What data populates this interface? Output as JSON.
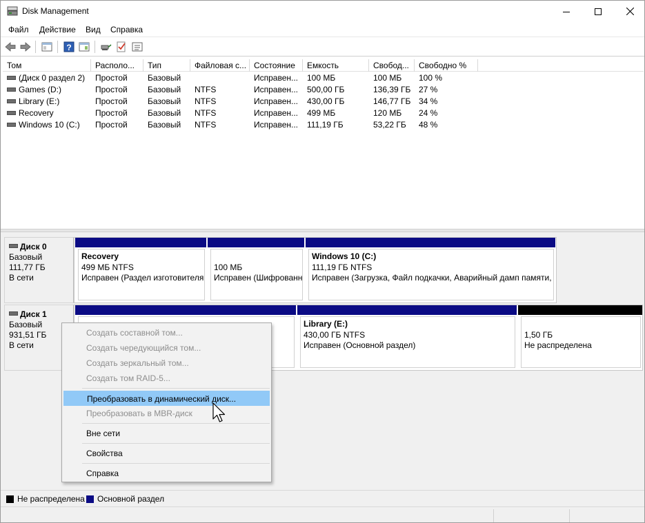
{
  "window": {
    "title": "Disk Management"
  },
  "menu": [
    "Файл",
    "Действие",
    "Вид",
    "Справка"
  ],
  "table": {
    "columns": [
      "Том",
      "Располо...",
      "Тип",
      "Файловая с...",
      "Состояние",
      "Емкость",
      "Свобод...",
      "Свободно %"
    ],
    "rows": [
      [
        "(Диск 0 раздел 2)",
        "Простой",
        "Базовый",
        "",
        "Исправен...",
        "100 МБ",
        "100 МБ",
        "100 %"
      ],
      [
        "Games (D:)",
        "Простой",
        "Базовый",
        "NTFS",
        "Исправен...",
        "500,00 ГБ",
        "136,39 ГБ",
        "27 %"
      ],
      [
        "Library (E:)",
        "Простой",
        "Базовый",
        "NTFS",
        "Исправен...",
        "430,00 ГБ",
        "146,77 ГБ",
        "34 %"
      ],
      [
        "Recovery",
        "Простой",
        "Базовый",
        "NTFS",
        "Исправен...",
        "499 МБ",
        "120 МБ",
        "24 %"
      ],
      [
        "Windows 10 (C:)",
        "Простой",
        "Базовый",
        "NTFS",
        "Исправен...",
        "111,19 ГБ",
        "53,22 ГБ",
        "48 %"
      ]
    ]
  },
  "disk0": {
    "name": "Диск 0",
    "type": "Базовый",
    "size": "111,77 ГБ",
    "status": "В сети",
    "partitions": [
      {
        "title": "Recovery",
        "size": "499 МБ NTFS",
        "status": "Исправен (Раздел изготовителя"
      },
      {
        "title": "",
        "size": "100 МБ",
        "status": "Исправен (Шифрованн"
      },
      {
        "title": "Windows 10  (C:)",
        "size": "111,19 ГБ NTFS",
        "status": "Исправен (Загрузка, Файл подкачки, Аварийный дамп памяти,"
      }
    ]
  },
  "disk1": {
    "name": "Диск 1",
    "type": "Базовый",
    "size": "931,51 ГБ",
    "status": "В сети",
    "partitions": [
      {
        "title": "Library  (E:)",
        "size": "430,00 ГБ NTFS",
        "status": "Исправен (Основной раздел)"
      },
      {
        "title": "",
        "size": "1,50 ГБ",
        "status": "Не распределена"
      }
    ]
  },
  "context_menu": {
    "items": [
      {
        "label": "Создать составной том...",
        "disabled": true
      },
      {
        "label": "Создать чередующийся том...",
        "disabled": true
      },
      {
        "label": "Создать зеркальный том...",
        "disabled": true
      },
      {
        "label": "Создать том RAID-5...",
        "disabled": true
      },
      {
        "label": "Преобразовать в динамический диск...",
        "disabled": false,
        "highlighted": true
      },
      {
        "label": "Преобразовать в MBR-диск",
        "disabled": true
      },
      {
        "label": "Вне сети",
        "disabled": false
      },
      {
        "label": "Свойства",
        "disabled": false
      },
      {
        "label": "Справка",
        "disabled": false
      }
    ]
  },
  "legend": [
    {
      "label": "Не распределена",
      "color": "#000000"
    },
    {
      "label": "Основной раздел",
      "color": "#0b0b84"
    }
  ],
  "icons": [
    "disk-management-icon",
    "back-arrow-icon",
    "forward-arrow-icon",
    "console-tree-icon",
    "help-icon",
    "action-pane-icon",
    "connect-icon",
    "check-icon",
    "properties-icon",
    "disk-icon",
    "volume-icon",
    "mouse-cursor-icon"
  ]
}
